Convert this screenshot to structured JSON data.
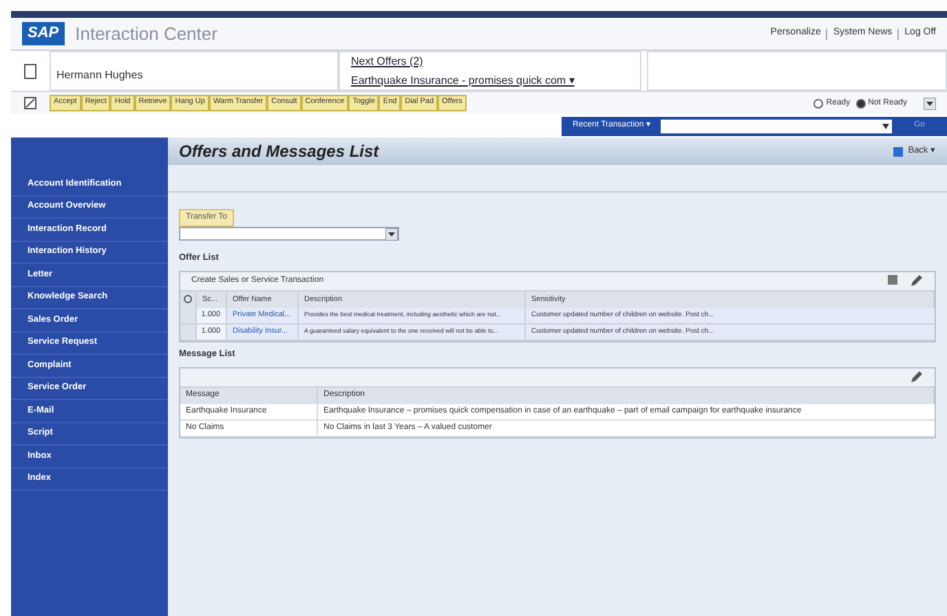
{
  "header": {
    "logo": "SAP",
    "title": "Interaction Center",
    "links": [
      "Personalize",
      "System News",
      "Log Off"
    ]
  },
  "context": {
    "customer": "Hermann Hughes",
    "next_offers": "Next Offers (2)",
    "current_offer": "Earthquake Insurance - promises quick com ▾"
  },
  "toolbar": {
    "buttons": [
      "Accept",
      "Reject",
      "Hold",
      "Retrieve",
      "Hang Up",
      "Warm Transfer",
      "Consult",
      "Conference",
      "Toggle",
      "End",
      "Dial Pad",
      "Offers"
    ],
    "ready": {
      "label": "Ready",
      "selected": false
    },
    "not_ready": {
      "label": "Not Ready",
      "selected": true
    }
  },
  "recent": {
    "label": "Recent Transaction ▾",
    "go": "Go"
  },
  "sidebar": {
    "items": [
      "Account Identification",
      "Account Overview",
      "Interaction Record",
      "Interaction History",
      "Letter",
      "Knowledge Search",
      "Sales Order",
      "Service Request",
      "Complaint",
      "Service Order",
      "E-Mail",
      "Script",
      "Inbox",
      "Index"
    ]
  },
  "page": {
    "title": "Offers and Messages List",
    "back": "Back ▾",
    "transfer_button": "Transfer To",
    "offer_list": {
      "label": "Offer List",
      "toolbar_title": "Create Sales or Service Transaction",
      "columns": [
        "Sc...",
        "Offer Name",
        "Description",
        "Sensitivity"
      ],
      "rows": [
        {
          "score": "1.000",
          "name": "Private Medical...",
          "description": "Provides the best medical treatment, including aesthetic which are not...",
          "sensitivity": "Customer updated number of children on website. Post ch..."
        },
        {
          "score": "1.000",
          "name": "Disability Insur...",
          "description": "A guaranteed salary equivalent to the one received will not be able to...",
          "sensitivity": "Customer updated number of children on website. Post ch..."
        }
      ]
    },
    "message_list": {
      "label": "Message List",
      "columns": [
        "Message",
        "Description"
      ],
      "rows": [
        {
          "message": "Earthquake Insurance",
          "description": "Earthquake Insurance – promises quick compensation in case of an earthquake – part of email campaign for earthquake insurance"
        },
        {
          "message": "No Claims",
          "description": "No Claims in last 3 Years – A valued customer"
        }
      ]
    }
  }
}
